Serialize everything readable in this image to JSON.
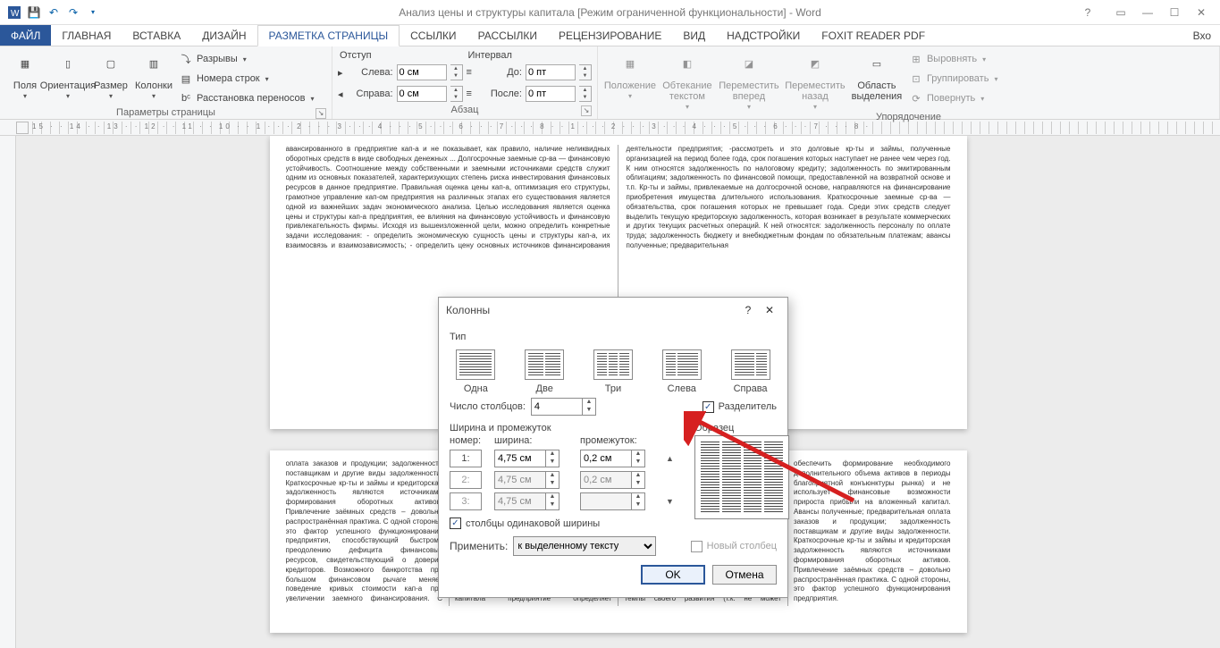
{
  "window": {
    "title": "Анализ цены и структуры капитала [Режим ограниченной функциональности] - Word",
    "signin": "Вхо"
  },
  "tabs": {
    "file": "ФАЙЛ",
    "items": [
      "ГЛАВНАЯ",
      "ВСТАВКА",
      "ДИЗАЙН",
      "РАЗМЕТКА СТРАНИЦЫ",
      "ССЫЛКИ",
      "РАССЫЛКИ",
      "РЕЦЕНЗИРОВАНИЕ",
      "ВИД",
      "НАДСТРОЙКИ",
      "FOXIT READER PDF"
    ],
    "active_index": 3
  },
  "ribbon": {
    "page_setup": {
      "label": "Параметры страницы",
      "fields": "Поля",
      "orientation": "Ориентация",
      "size": "Размер",
      "columns": "Колонки",
      "breaks": "Разрывы",
      "line_numbers": "Номера строк",
      "hyphenation": "Расстановка переносов"
    },
    "paragraph": {
      "label": "Абзац",
      "indent_label": "Отступ",
      "spacing_label": "Интервал",
      "left_lbl": "Слева:",
      "right_lbl": "Справа:",
      "before_lbl": "До:",
      "after_lbl": "После:",
      "left": "0 см",
      "right": "0 см",
      "before": "0 пт",
      "after": "0 пт"
    },
    "arrange": {
      "label": "Упорядочение",
      "position": "Положение",
      "wrap": "Обтекание текстом",
      "forward": "Переместить вперед",
      "backward": "Переместить назад",
      "selection": "Область выделения",
      "align": "Выровнять",
      "group": "Группировать",
      "rotate": "Повернуть"
    }
  },
  "ruler_numbers": "15 · · 14 · · 13 · · 12 · · 11 · · 10            · · 1 · · · 2 · · · 3 · · · 4 · · · 5 · · · 6 · · · 7 · · · 8 · ·          1 · · · 2 · · · 3 · · · 4 · · · 5 · · · 6 · · · 7 · · · 8 ·",
  "dialog": {
    "title": "Колонны",
    "type_label": "Тип",
    "presets": [
      "Одна",
      "Две",
      "Три",
      "Слева",
      "Справа"
    ],
    "count_label": "Число столбцов:",
    "count_value": "4",
    "divider_label": "Разделитель",
    "width_label": "Ширина и промежуток",
    "preview_label": "Образец",
    "col_num": "номер:",
    "col_width": "ширина:",
    "col_gap": "промежуток:",
    "rows": [
      {
        "n": "1:",
        "w": "4,75 см",
        "g": "0,2 см",
        "enabled": true
      },
      {
        "n": "2:",
        "w": "4,75 см",
        "g": "0,2 см",
        "enabled": false
      },
      {
        "n": "3:",
        "w": "4,75 см",
        "g": "",
        "enabled": false
      }
    ],
    "equal_width": "столбцы одинаковой ширины",
    "apply_label": "Применить:",
    "apply_value": "к выделенному тексту",
    "new_column": "Новый столбец",
    "ok": "OK",
    "cancel": "Отмена"
  },
  "doc": {
    "p1": "авансированного в предприятие кап-а и не показывает, как правило, наличие неликвидных оборотных средств в виде свободных денежных ...  Долгосрочные заемные ср-ва — финансовую устойчивость. Соотношение между собственными и заемными источниками средств служит одним из основных показателей, характеризующих степень риска инвестирования финансовых ресурсов в данное предприятие. Правильная оценка цены кап-а, оптимизация его структуры, грамотное управление кап-ом предприятия на различных этапах его существования является одной из важнейших задач экономического анализа. Целью исследования является оценка цены и структуры кап-а предприятия, ее влияния на финансовую устойчивость и финансовую привлекательность фирмы. Исходя из вышеизложенной цели, можно определить конкретные задачи исследования: - определить экономическую сущность цены и структуры кап-а, их взаимосвязь и взаимозависимость; - определить цену основных источников финансирования деятельности предприятия; -рассмотреть и это долговые кр-ты и займы, полученные организацией на период более года, срок погашения которых наступает не ранее чем через год. К ним относятся задолженность по налоговому кредиту; задолженность по эмитированным облигациям; задолженность по финансовой помощи, предоставленной на возвратной основе и т.п. Кр-ты и займы, привлекаемые на долгосрочной основе, направляются на финансирование приобретения имущества длительного использования. Краткосрочные заемные ср-ва — обязательства, срок погашения которых не превышает года. Среди этих средств следует выделить текущую кредиторскую задолженность, которая возникает в результате коммерческих и других текущих расчетных операций. К ней относятся: задолженность персоналу по оплате труда; задолженность бюджету и внебюджетным фондам по обязательным платежам; авансы полученные; предварительная",
    "p2": "оплата заказов и продукции; задолженность поставщикам и другие виды задолженности. Краткосрочные кр-ты и займы и кредиторская задолженность являются источниками формирования оборотных активов. Привлечение заёмных средств – довольно распространённая практика. С одной стороны, это фактор успешного функционирования предприятия, способствующий быстрому преодолению дефицита финансовых ресурсов, свидетельствующий о доверии кредиторов. Возможного банкротства при большом финансовом рычаге меняет поведение кривых стоимости кап-а при увеличении заемного финансирования. С ростом финансового рычага стоим-ть заемного и акционерного кап-а растет. Современные теории структуры кап-а формируют достаточно обширный методический инструментарий оптимизации этого показателя на каждом конкретном предприятии. Основными критериями такой оптимизации выступают: • приемлемый уровень доходности и риска в деятельности предприятия; • минимизация средневзвешенной стоимости капитала предприятия; • максимизация рыночной стоимости предприятия. Приоритет конкретных критериев оптимизации структуры капитала предприятие определяет самостоятельно. Поэтому можно сделать вывод: не существует единой оптимальной структуры капитала не только для разных предприятий, но даже и для одного предприятия на разных стадиях его развития. Эти статьи формируются в соответствии с законодательством, учредительными документами и учетной политикой. Все источники формирования собственного кап-а можно разделить на внутренние и внешние. Таким образом, предприятие, использующее только собственный кап-л, имеет наивысшую финансовую устойчивость (его коэффициент автономии равен единице), но ограничивает темпы своего развития (т.к. не может обеспечить формирование необходимого дополнительного объема активов в периоды благоприятной конъюнктуры рынка) и не использует финансовые возможности прироста прибыли на вложенный капитал. Авансы полученные; предварительная оплата заказов и продукции; задолженность поставщикам и другие виды задолженности. Краткосрочные кр-ты и займы и кредиторская задолженность являются источниками формирования оборотных активов. Привлечение заёмных средств – довольно распространённая практика. С одной стороны, это фактор успешного функционирования предприятия."
  }
}
